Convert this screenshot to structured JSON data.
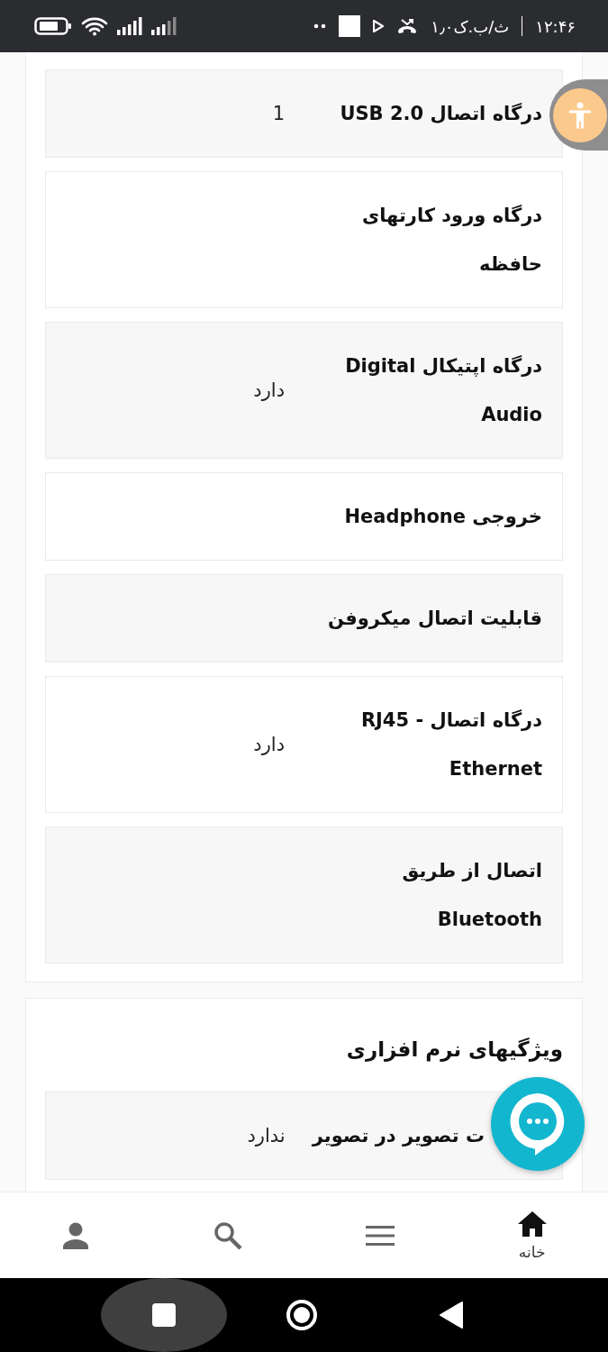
{
  "status_bar": {
    "time": "۱۲:۴۶",
    "speed": "۱٫۰ک.ب/ث"
  },
  "spec_rows": [
    {
      "label": "درگاه اتصال USB 2.0",
      "value": "1"
    },
    {
      "label": "درگاه ورود کارتهای حافظه"
    },
    {
      "label": "درگاه اپتیکال Digital Audio",
      "value": "دارد"
    },
    {
      "label": "خروجی Headphone"
    },
    {
      "label": "قابلیت اتصال میکروفن"
    },
    {
      "label": "درگاه اتصال - RJ45 Ethernet",
      "value": "دارد"
    },
    {
      "label": "اتصال از طریق Bluetooth"
    }
  ],
  "software_section": {
    "title": "ویژگیهای نرم افزاری",
    "rows": [
      {
        "label": "ت تصویر در تصویر",
        "value": "ندارد"
      }
    ]
  },
  "bottom_nav": [
    {
      "kind": "home",
      "label": "خانه",
      "selected": true
    },
    {
      "kind": "menu",
      "selected": false
    },
    {
      "kind": "search",
      "selected": false
    },
    {
      "kind": "account",
      "selected": false
    }
  ]
}
